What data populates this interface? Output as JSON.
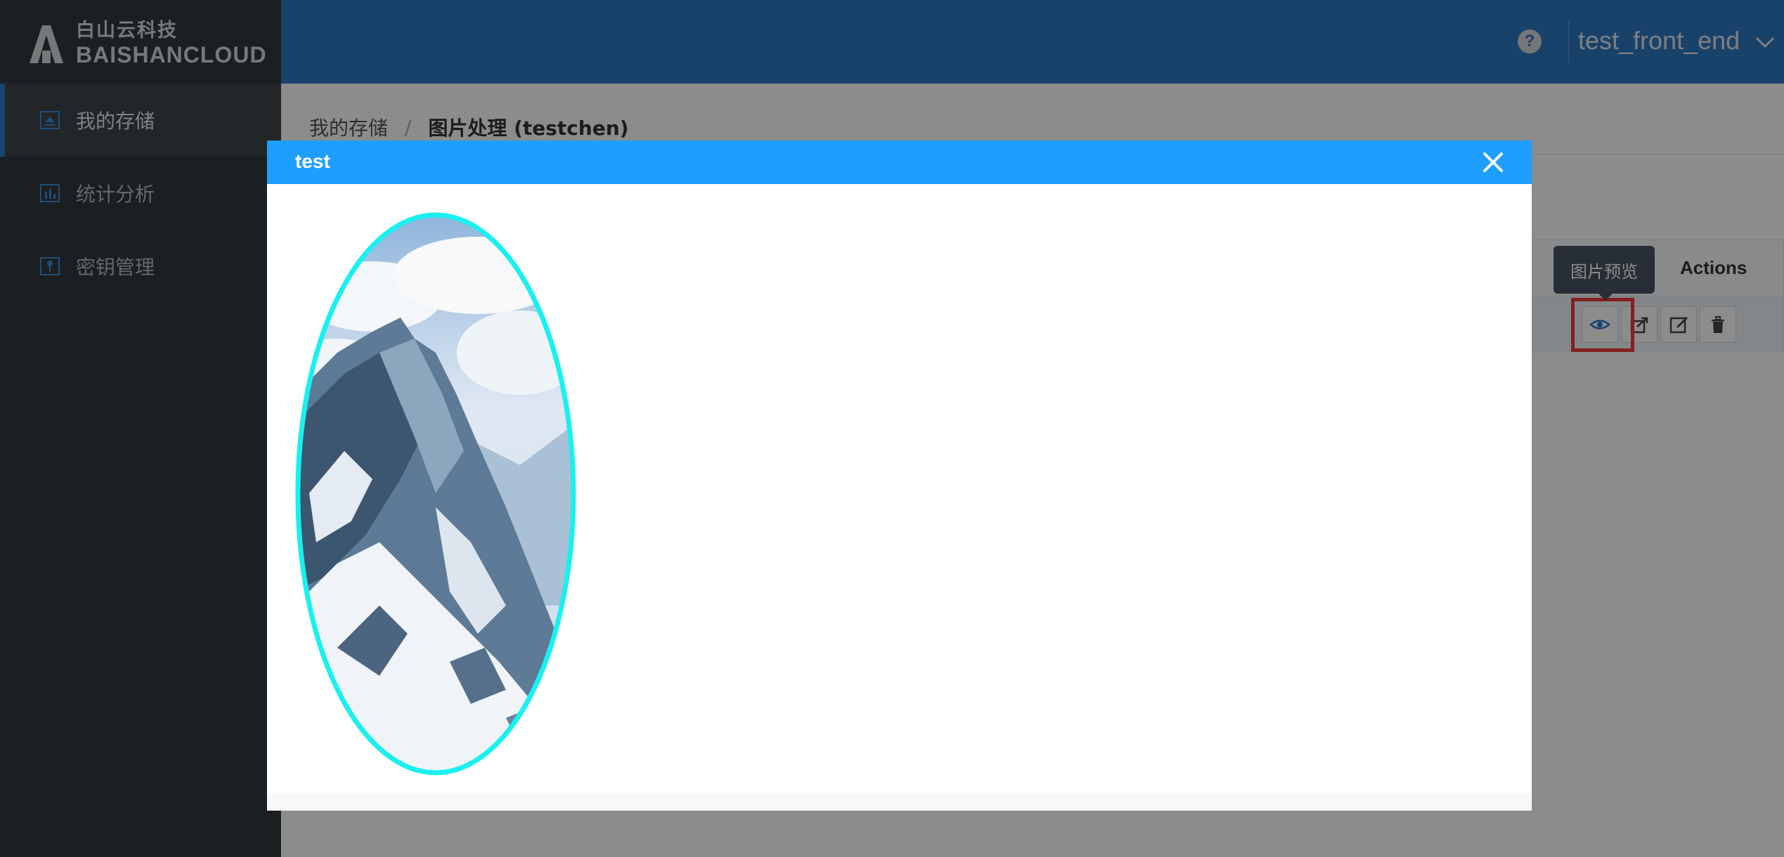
{
  "brand": {
    "name_cn": "白山云科技",
    "name_en": "BAISHANCLOUD"
  },
  "sidebar": {
    "items": [
      {
        "label": "我的存储",
        "icon": "storage-icon",
        "active": true
      },
      {
        "label": "统计分析",
        "icon": "bar-chart-icon",
        "active": false
      },
      {
        "label": "密钥管理",
        "icon": "key-icon",
        "active": false
      }
    ]
  },
  "header": {
    "help_icon": "question-circle-icon",
    "username": "test_front_end",
    "dropdown_icon": "chevron-down-icon"
  },
  "breadcrumb": {
    "root": "我的存储",
    "separator": "/",
    "current": "图片处理 (testchen)"
  },
  "table": {
    "actions_header": "Actions",
    "row_actions": [
      "eye-icon",
      "share-icon",
      "edit-icon",
      "trash-icon"
    ]
  },
  "tooltip": {
    "text": "图片预览"
  },
  "modal": {
    "title": "test",
    "close_icon": "close-icon",
    "image": "mountain-preview-image"
  },
  "colors": {
    "sidebar_bg": "#33393d",
    "header_bg": "#2e78c4",
    "modal_header_bg": "#1e9fff",
    "highlight": "#f03a3a",
    "image_border": "#19f0f0"
  }
}
